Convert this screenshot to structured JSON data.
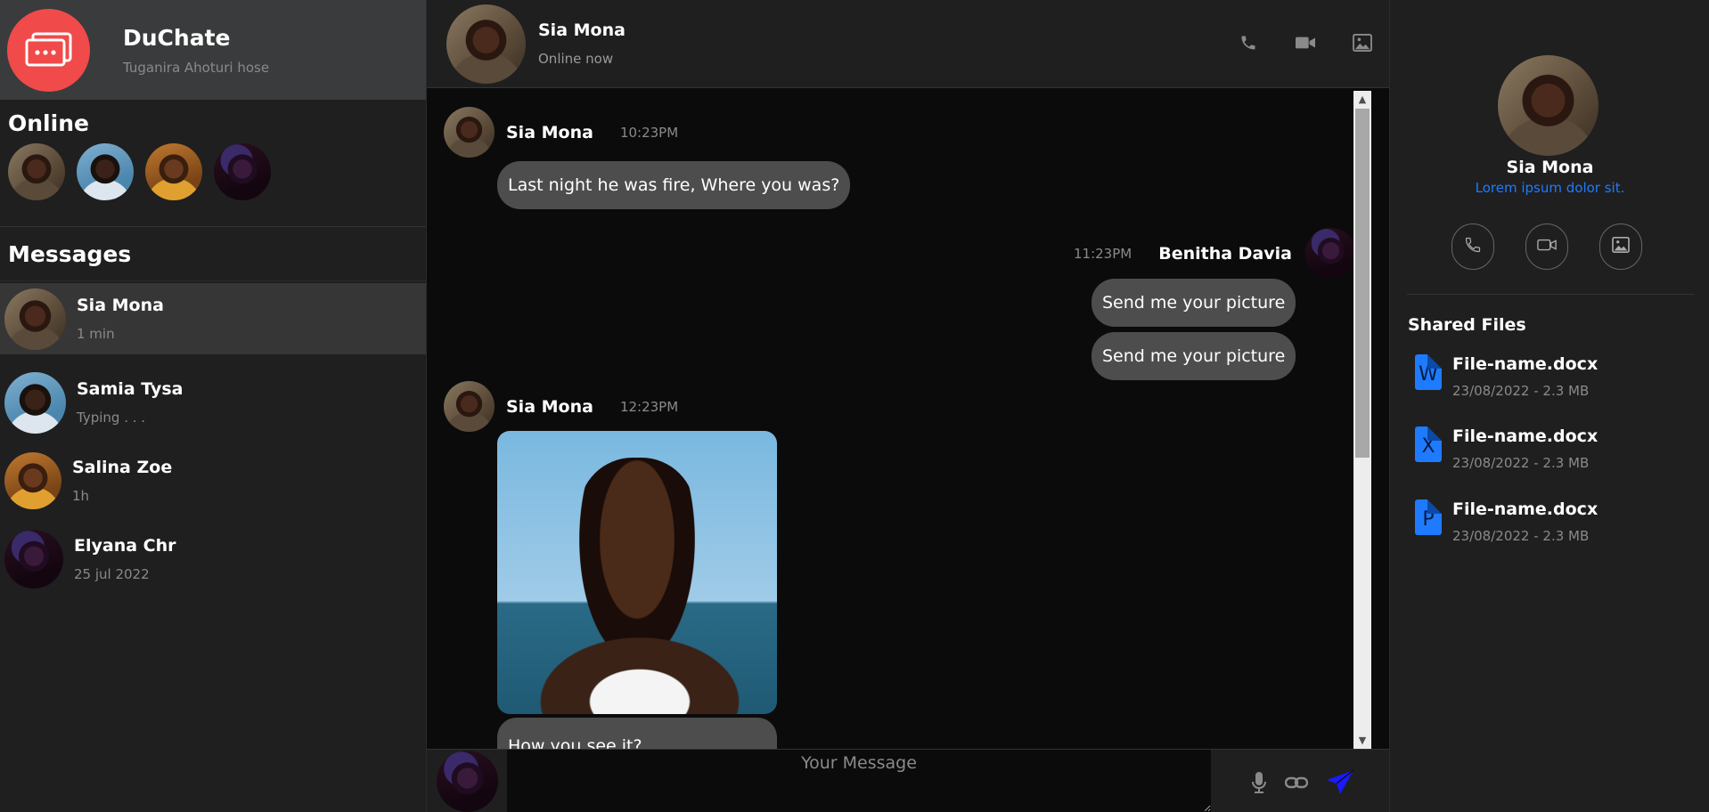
{
  "brand": {
    "title": "DuChate",
    "subtitle": "Tuganira Ahoturi hose"
  },
  "online": {
    "title": "Online"
  },
  "messages": {
    "title": "Messages",
    "conversations": [
      {
        "name": "Sia Mona",
        "sub": "1 min"
      },
      {
        "name": "Samia Tysa",
        "sub": "Typing . . ."
      },
      {
        "name": "Salina Zoe",
        "sub": "1h"
      },
      {
        "name": "Elyana Chr",
        "sub": "25 jul 2022"
      }
    ]
  },
  "chat": {
    "header_name": "Sia Mona",
    "header_status": "Online now",
    "m1": {
      "name": "Sia Mona",
      "time": "10:23PM",
      "text": "Last night he was fire, Where you was?"
    },
    "m2": {
      "name": "Benitha Davia",
      "time": "11:23PM",
      "text1": "Send me your picture",
      "text2": "Send me your picture"
    },
    "m3": {
      "name": "Sia Mona",
      "time": "12:23PM",
      "caption": "How you see it?"
    },
    "composer_placeholder": "Your Message"
  },
  "profile": {
    "name": "Sia Mona",
    "sub": "Lorem ipsum dolor sit.",
    "shared_title": "Shared Files",
    "files": [
      {
        "letter": "W",
        "name": "File-name.docx",
        "meta": "23/08/2022 - 2.3 MB"
      },
      {
        "letter": "X",
        "name": "File-name.docx",
        "meta": "23/08/2022 - 2.3 MB"
      },
      {
        "letter": "P",
        "name": "File-name.docx",
        "meta": "23/08/2022 - 2.3 MB"
      }
    ]
  },
  "colors": {
    "accent": "#1e7bff",
    "brand": "#f04a4a",
    "send": "#1a1aff"
  },
  "icons": [
    "phone-icon",
    "video-icon",
    "image-icon",
    "mic-icon",
    "link-icon",
    "send-icon"
  ]
}
